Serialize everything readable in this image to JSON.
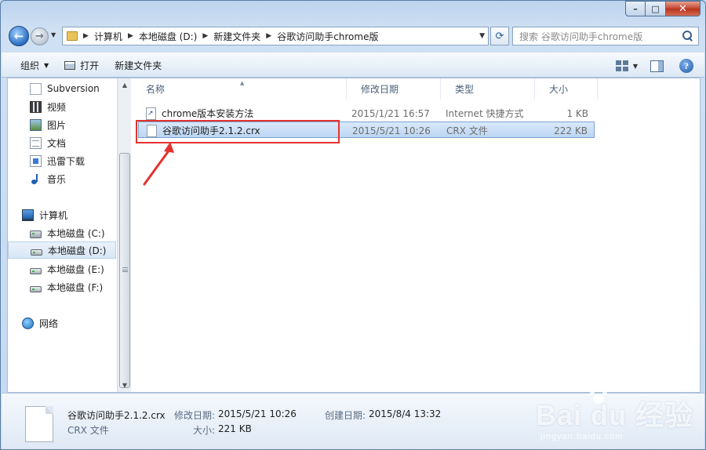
{
  "window": {
    "min_glyph": "–",
    "max_glyph": "□",
    "close_glyph": "✕"
  },
  "address": {
    "crumbs": [
      "计算机",
      "本地磁盘 (D:)",
      "新建文件夹",
      "谷歌访问助手chrome版"
    ],
    "search_placeholder": "搜索 谷歌访问助手chrome版"
  },
  "toolbar": {
    "organize_label": "组织",
    "open_label": "打开",
    "new_folder_label": "新建文件夹"
  },
  "sidebar": {
    "favorites": [
      {
        "label": "Subversion",
        "icon": "subversion-icon"
      },
      {
        "label": "视频",
        "icon": "video-library-icon"
      },
      {
        "label": "图片",
        "icon": "pictures-library-icon"
      },
      {
        "label": "文档",
        "icon": "documents-library-icon"
      },
      {
        "label": "迅雷下载",
        "icon": "thunder-download-icon"
      },
      {
        "label": "音乐",
        "icon": "music-library-icon"
      }
    ],
    "computer_label": "计算机",
    "drives": [
      {
        "label": "本地磁盘 (C:)",
        "selected": false
      },
      {
        "label": "本地磁盘 (D:)",
        "selected": true
      },
      {
        "label": "本地磁盘 (E:)",
        "selected": false
      },
      {
        "label": "本地磁盘 (F:)",
        "selected": false
      }
    ],
    "network_label": "网络"
  },
  "columns": {
    "name": "名称",
    "modified": "修改日期",
    "type": "类型",
    "size": "大小"
  },
  "files": [
    {
      "name": "chrome版本安装方法",
      "modified": "2015/1/21 16:57",
      "type": "Internet 快捷方式",
      "size": "1 KB",
      "icon": "internet-shortcut-icon",
      "selected": false
    },
    {
      "name": "谷歌访问助手2.1.2.crx",
      "modified": "2015/5/21 10:26",
      "type": "CRX 文件",
      "size": "222 KB",
      "icon": "crx-file-icon",
      "selected": true
    }
  ],
  "details": {
    "file_name": "谷歌访问助手2.1.2.crx",
    "file_type": "CRX 文件",
    "modified_label": "修改日期:",
    "modified_value": "2015/5/21 10:26",
    "size_label": "大小:",
    "size_value": "221 KB",
    "created_label": "创建日期:",
    "created_value": "2015/8/4 13:32"
  },
  "watermark": {
    "logo_text": "Bai du 经验",
    "sub_text": "jingyan.baidu.com"
  },
  "colors": {
    "annotation": "#e5322d",
    "selection": "#bcd6f3"
  }
}
